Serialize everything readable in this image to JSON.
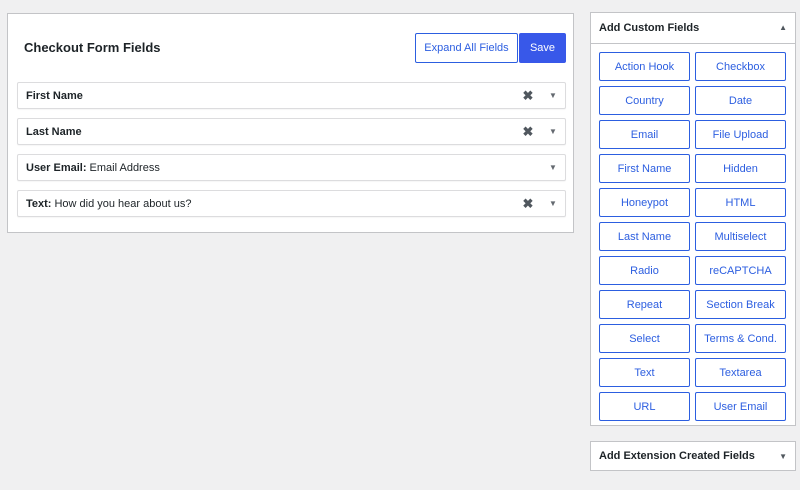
{
  "main": {
    "title": "Checkout Form Fields",
    "expand_label": "Expand All Fields",
    "save_label": "Save",
    "fields": [
      {
        "type": "First Name",
        "label": "",
        "removable": true
      },
      {
        "type": "Last Name",
        "label": "",
        "removable": true
      },
      {
        "type": "User Email:",
        "label": "Email Address",
        "removable": false
      },
      {
        "type": "Text:",
        "label": "How did you hear about us?",
        "removable": true
      }
    ],
    "remove_glyph": "✖",
    "toggle_glyph": "▼"
  },
  "custom": {
    "title": "Add Custom Fields",
    "collapse_glyph": "▲",
    "buttons": [
      "Action Hook",
      "Checkbox",
      "Country",
      "Date",
      "Email",
      "File Upload",
      "First Name",
      "Hidden",
      "Honeypot",
      "HTML",
      "Last Name",
      "Multiselect",
      "Radio",
      "reCAPTCHA",
      "Repeat",
      "Section Break",
      "Select",
      "Terms & Cond.",
      "Text",
      "Textarea",
      "URL",
      "User Email"
    ]
  },
  "extension": {
    "title": "Add Extension Created Fields",
    "expand_glyph": "▼"
  },
  "colors": {
    "accent": "#3858e9",
    "link": "#2c5ee0",
    "background": "#f0f0f1",
    "border": "#c3c4c7"
  }
}
